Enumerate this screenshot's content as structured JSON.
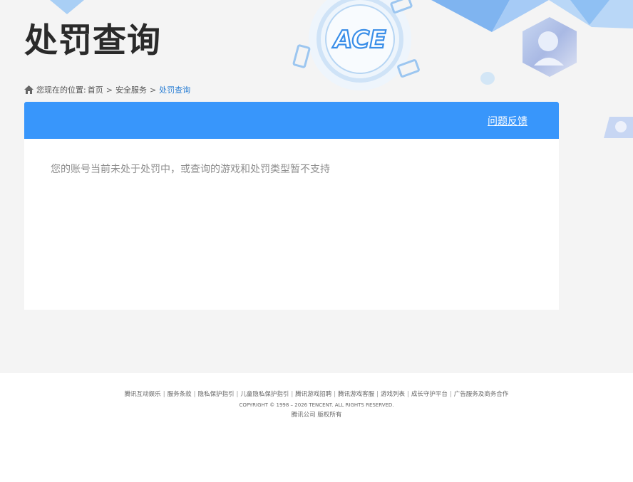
{
  "header": {
    "title": "处罚查询",
    "logo_text": "ACE"
  },
  "breadcrumb": {
    "prefix": "您现在的位置:",
    "items": [
      "首页",
      "安全服务"
    ],
    "separator": ">",
    "current": "处罚查询"
  },
  "panel": {
    "feedback_label": "问题反馈",
    "message": "您的账号当前未处于处罚中，或查询的游戏和处罚类型暂不支持"
  },
  "footer": {
    "links": [
      "腾讯互动娱乐",
      "服务条款",
      "隐私保护指引",
      "儿童隐私保护指引",
      "腾讯游戏招聘",
      "腾讯游戏客服",
      "游戏列表",
      "成长守护平台",
      "广告服务及商务合作"
    ],
    "separator": "|",
    "copyright": "COPYRIGHT © 1998 – 2026 TENCENT. ALL RIGHTS RESERVED.",
    "company": "腾讯公司 版权所有"
  },
  "colors": {
    "accent": "#3896fb",
    "breadcrumb_current": "#2b7fd4",
    "page_bg": "#f4f4f4"
  },
  "icons": [
    "home-icon",
    "ace-logo-icon",
    "hexagon-character-avatar",
    "side-character-avatar"
  ]
}
